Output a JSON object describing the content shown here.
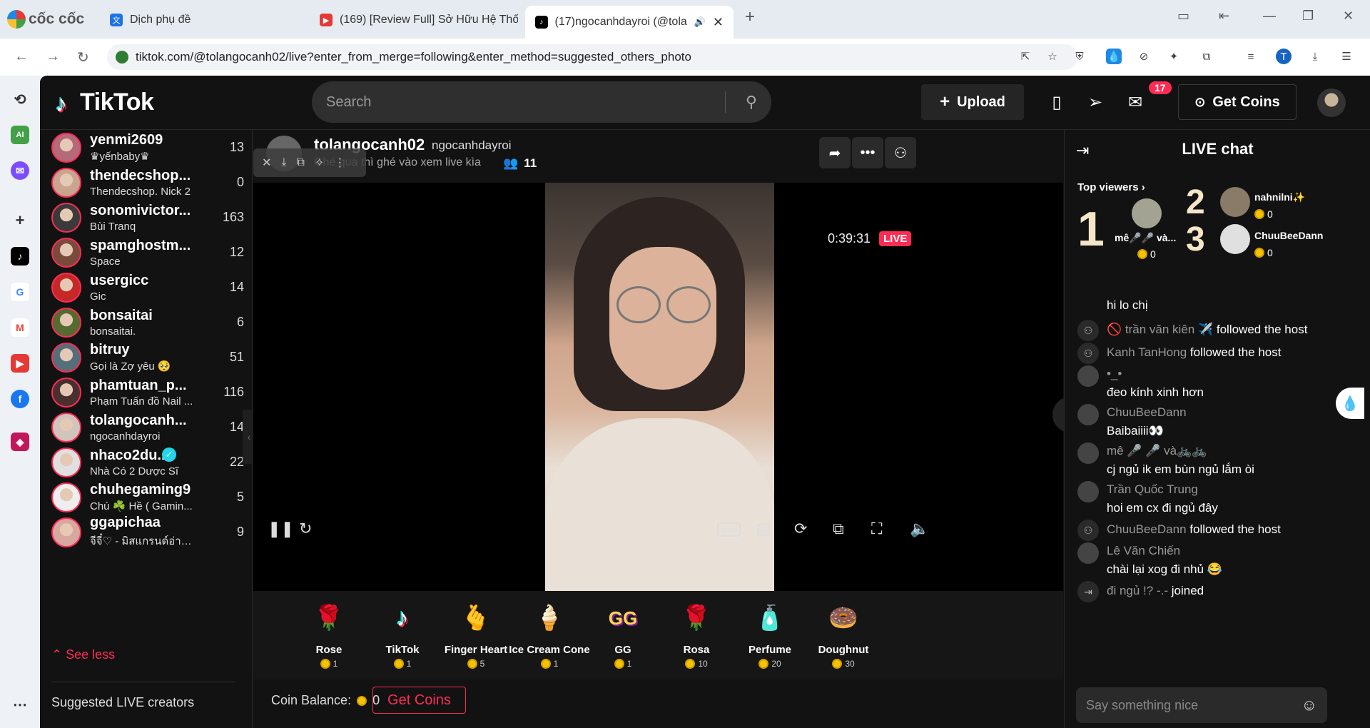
{
  "browser": {
    "brand": "cốc cốc",
    "tabs": [
      {
        "title": "Dịch phụ đề",
        "icon": "translate-icon",
        "color": "#1a73e8"
      },
      {
        "title": "(169) [Review Full] Sở Hữu Hệ Thống",
        "icon": "youtube-icon",
        "color": "#e53935"
      },
      {
        "title": "(17)ngocanhdayroi (@tolan",
        "icon": "tiktok-icon",
        "color": "#000000",
        "active": true
      }
    ],
    "url": "tiktok.com/@tolangocanh02/live?enter_from_merge=following&enter_method=suggested_others_photo",
    "profile_initial": "T"
  },
  "rail": {
    "ai_label": "AI"
  },
  "header": {
    "logo": "TikTok",
    "search_placeholder": "Search",
    "upload_label": "Upload",
    "notif_count": "17",
    "get_coins_label": "Get Coins"
  },
  "sidebar": {
    "accounts": [
      {
        "name": "yenmi2609",
        "sub": "♛yếnbaby♛",
        "count": "13",
        "color": "#b56a7a"
      },
      {
        "name": "thendecshop...",
        "sub": "Thendecshop. Nick 2",
        "count": "0",
        "color": "#c9a48f"
      },
      {
        "name": "sonomivictor...",
        "sub": "Bùi Tranq",
        "count": "163",
        "color": "#3a3a3a"
      },
      {
        "name": "spamghostm...",
        "sub": "Space",
        "count": "12",
        "color": "#7a4a3a"
      },
      {
        "name": "usergicc",
        "sub": "Gic",
        "count": "14",
        "color": "#c62828"
      },
      {
        "name": "bonsaitai",
        "sub": "bonsaitai.",
        "count": "6",
        "color": "#556b2f"
      },
      {
        "name": "bitruy",
        "sub": "Gọi là Zợ yêu 🥺",
        "count": "51",
        "color": "#546e7a"
      },
      {
        "name": "phamtuan_p...",
        "sub": "Phạm Tuấn đồ Nail ...",
        "count": "116",
        "color": "#4a2f2f"
      },
      {
        "name": "tolangocanh...",
        "sub": "ngocanhdayroi",
        "count": "14",
        "color": "#cfc5bc"
      },
      {
        "name": "nhaco2du...",
        "sub": "Nhà Có 2 Dược Sĩ",
        "count": "22",
        "color": "#e0e0e0",
        "verified": true
      },
      {
        "name": "chuhegaming9",
        "sub": "Chú ☘️ Hề ( Gamin...",
        "count": "5",
        "color": "#eeeeee"
      },
      {
        "name": "ggapichaa",
        "sub": "จีจี๋♡ - มิสแกรนด์อ่าน...",
        "count": "9",
        "color": "#d7a7a0"
      }
    ],
    "see_less": "See less",
    "suggested": "Suggested LIVE creators"
  },
  "stream": {
    "host_name": "tolangocanh02",
    "host_handle": "ngocanhdayroi",
    "subtitle": "Ghé qua thì ghé vào xem live kìa",
    "viewers": "11",
    "timer": "0:39:31",
    "live_label": "LIVE",
    "coin_balance_label": "Coin Balance:",
    "coin_balance": "0",
    "get_coins_label": "Get Coins",
    "gifts": [
      {
        "name": "Rose",
        "price": "1",
        "emoji": "🌹"
      },
      {
        "name": "TikTok",
        "price": "1",
        "emoji": "♪"
      },
      {
        "name": "Finger Heart",
        "price": "5",
        "emoji": "🫰"
      },
      {
        "name": "Ice Cream Cone",
        "price": "1",
        "emoji": "🍦"
      },
      {
        "name": "GG",
        "price": "1",
        "emoji": "GG"
      },
      {
        "name": "Rosa",
        "price": "10",
        "emoji": "🌹"
      },
      {
        "name": "Perfume",
        "price": "20",
        "emoji": "🧴"
      },
      {
        "name": "Doughnut",
        "price": "30",
        "emoji": "🍩"
      }
    ]
  },
  "chat": {
    "title": "LIVE chat",
    "top_viewers_label": "Top viewers",
    "top_viewers": [
      {
        "rank": "1",
        "name": "mê🎤🎤 và...",
        "coins": "0"
      },
      {
        "rank": "2",
        "name": "nahnilni✨",
        "coins": "0"
      },
      {
        "rank": "3",
        "name": "ChuuBeeDann",
        "coins": "0"
      }
    ],
    "messages": [
      {
        "type": "text",
        "user": "",
        "text": "hi lo chị"
      },
      {
        "type": "event",
        "user": "🚫 trần văn kiên ✈️",
        "text": "followed the host"
      },
      {
        "type": "event",
        "user": "Kanh TanHong",
        "text": "followed the host"
      },
      {
        "type": "text",
        "user": "•_•",
        "text": "đeo kính xinh hơn"
      },
      {
        "type": "text",
        "user": "ChuuBeeDann",
        "text": "Baibaiiii👀"
      },
      {
        "type": "text",
        "user": "mê 🎤 🎤 và🚲🚲",
        "text": "cj ngủ ik em bùn ngủ lắm òi"
      },
      {
        "type": "text",
        "user": "Trần Quốc Trung",
        "text": "hoi em cx đi ngủ đây"
      },
      {
        "type": "event",
        "user": "ChuuBeeDann",
        "text": "followed the host"
      },
      {
        "type": "text",
        "user": "Lê Văn Chiến",
        "text": "chài lại xog đi nhủ 😂"
      },
      {
        "type": "join",
        "user": "đi ngủ !? -.-",
        "text": "joined"
      }
    ],
    "input_placeholder": "Say something nice"
  },
  "colors": {
    "accent": "#fe2c55",
    "background": "#121212",
    "coin": "#f5c400"
  }
}
